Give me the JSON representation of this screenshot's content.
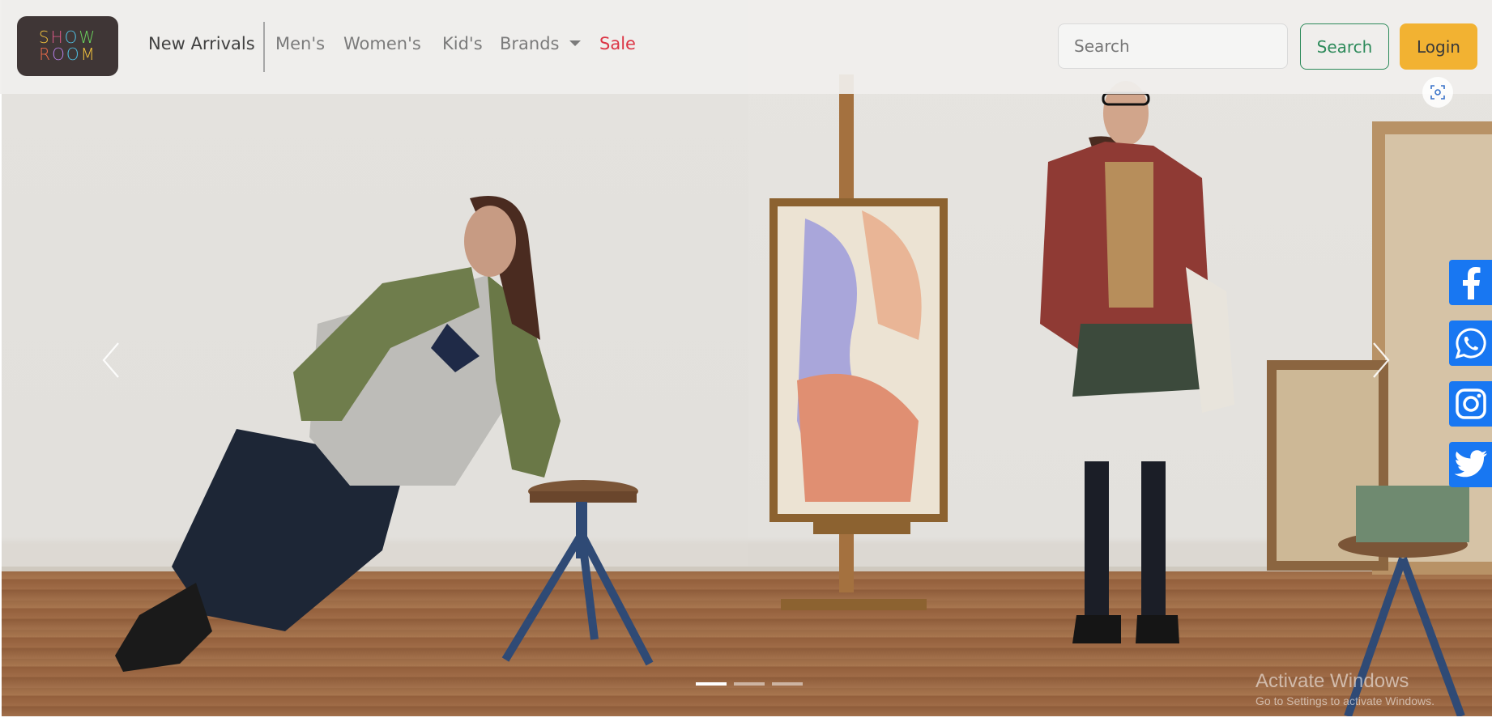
{
  "brand": {
    "logo_line1": [
      "S",
      "H",
      "O",
      "W"
    ],
    "logo_line2": [
      "R",
      "O",
      "O",
      "M"
    ],
    "logo_colors": [
      "#f2c23d",
      "#e05a8a",
      "#4fc3e8",
      "#6bd35d",
      "#ef6b4a",
      "#b57ee6",
      "#4fc3e8",
      "#f2c23d"
    ]
  },
  "nav": {
    "items": [
      {
        "label": "New Arrivals"
      },
      {
        "label": "Men's"
      },
      {
        "label": "Women's"
      },
      {
        "label": "Kid's"
      },
      {
        "label": "Brands"
      },
      {
        "label": "Sale"
      }
    ]
  },
  "search": {
    "placeholder": "Search",
    "button_label": "Search"
  },
  "auth": {
    "login_label": "Login"
  },
  "carousel": {
    "slide_count": 3,
    "active_index": 0,
    "prev_icon": "chevron-left-icon",
    "next_icon": "chevron-right-icon"
  },
  "social": {
    "items": [
      {
        "icon": "facebook-icon"
      },
      {
        "icon": "whatsapp-icon"
      },
      {
        "icon": "instagram-icon"
      },
      {
        "icon": "twitter-icon"
      }
    ]
  },
  "watermark": {
    "line1": "Activate Windows",
    "line2": "Go to Settings to activate Windows."
  },
  "colors": {
    "accent_green": "#2d8a5a",
    "login_yellow": "#f2b232",
    "sale_red": "#dc3545",
    "social_blue": "#1877f2"
  }
}
